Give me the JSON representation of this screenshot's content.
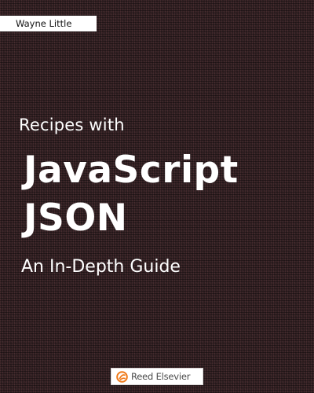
{
  "cover": {
    "author": "Wayne Little",
    "title_pre": "Recipes with",
    "title_line1": "JavaScript",
    "title_line2": "JSON",
    "subtitle": "An In-Depth Guide",
    "publisher": "Reed Elsevier",
    "publisher_logo_icon": "reed-elsevier-logo-icon"
  },
  "colors": {
    "background": "#2e1f21",
    "title_text": "#ffffff",
    "author_tab": "#ffffff",
    "publisher_logo_orange": "#f07a1a"
  }
}
